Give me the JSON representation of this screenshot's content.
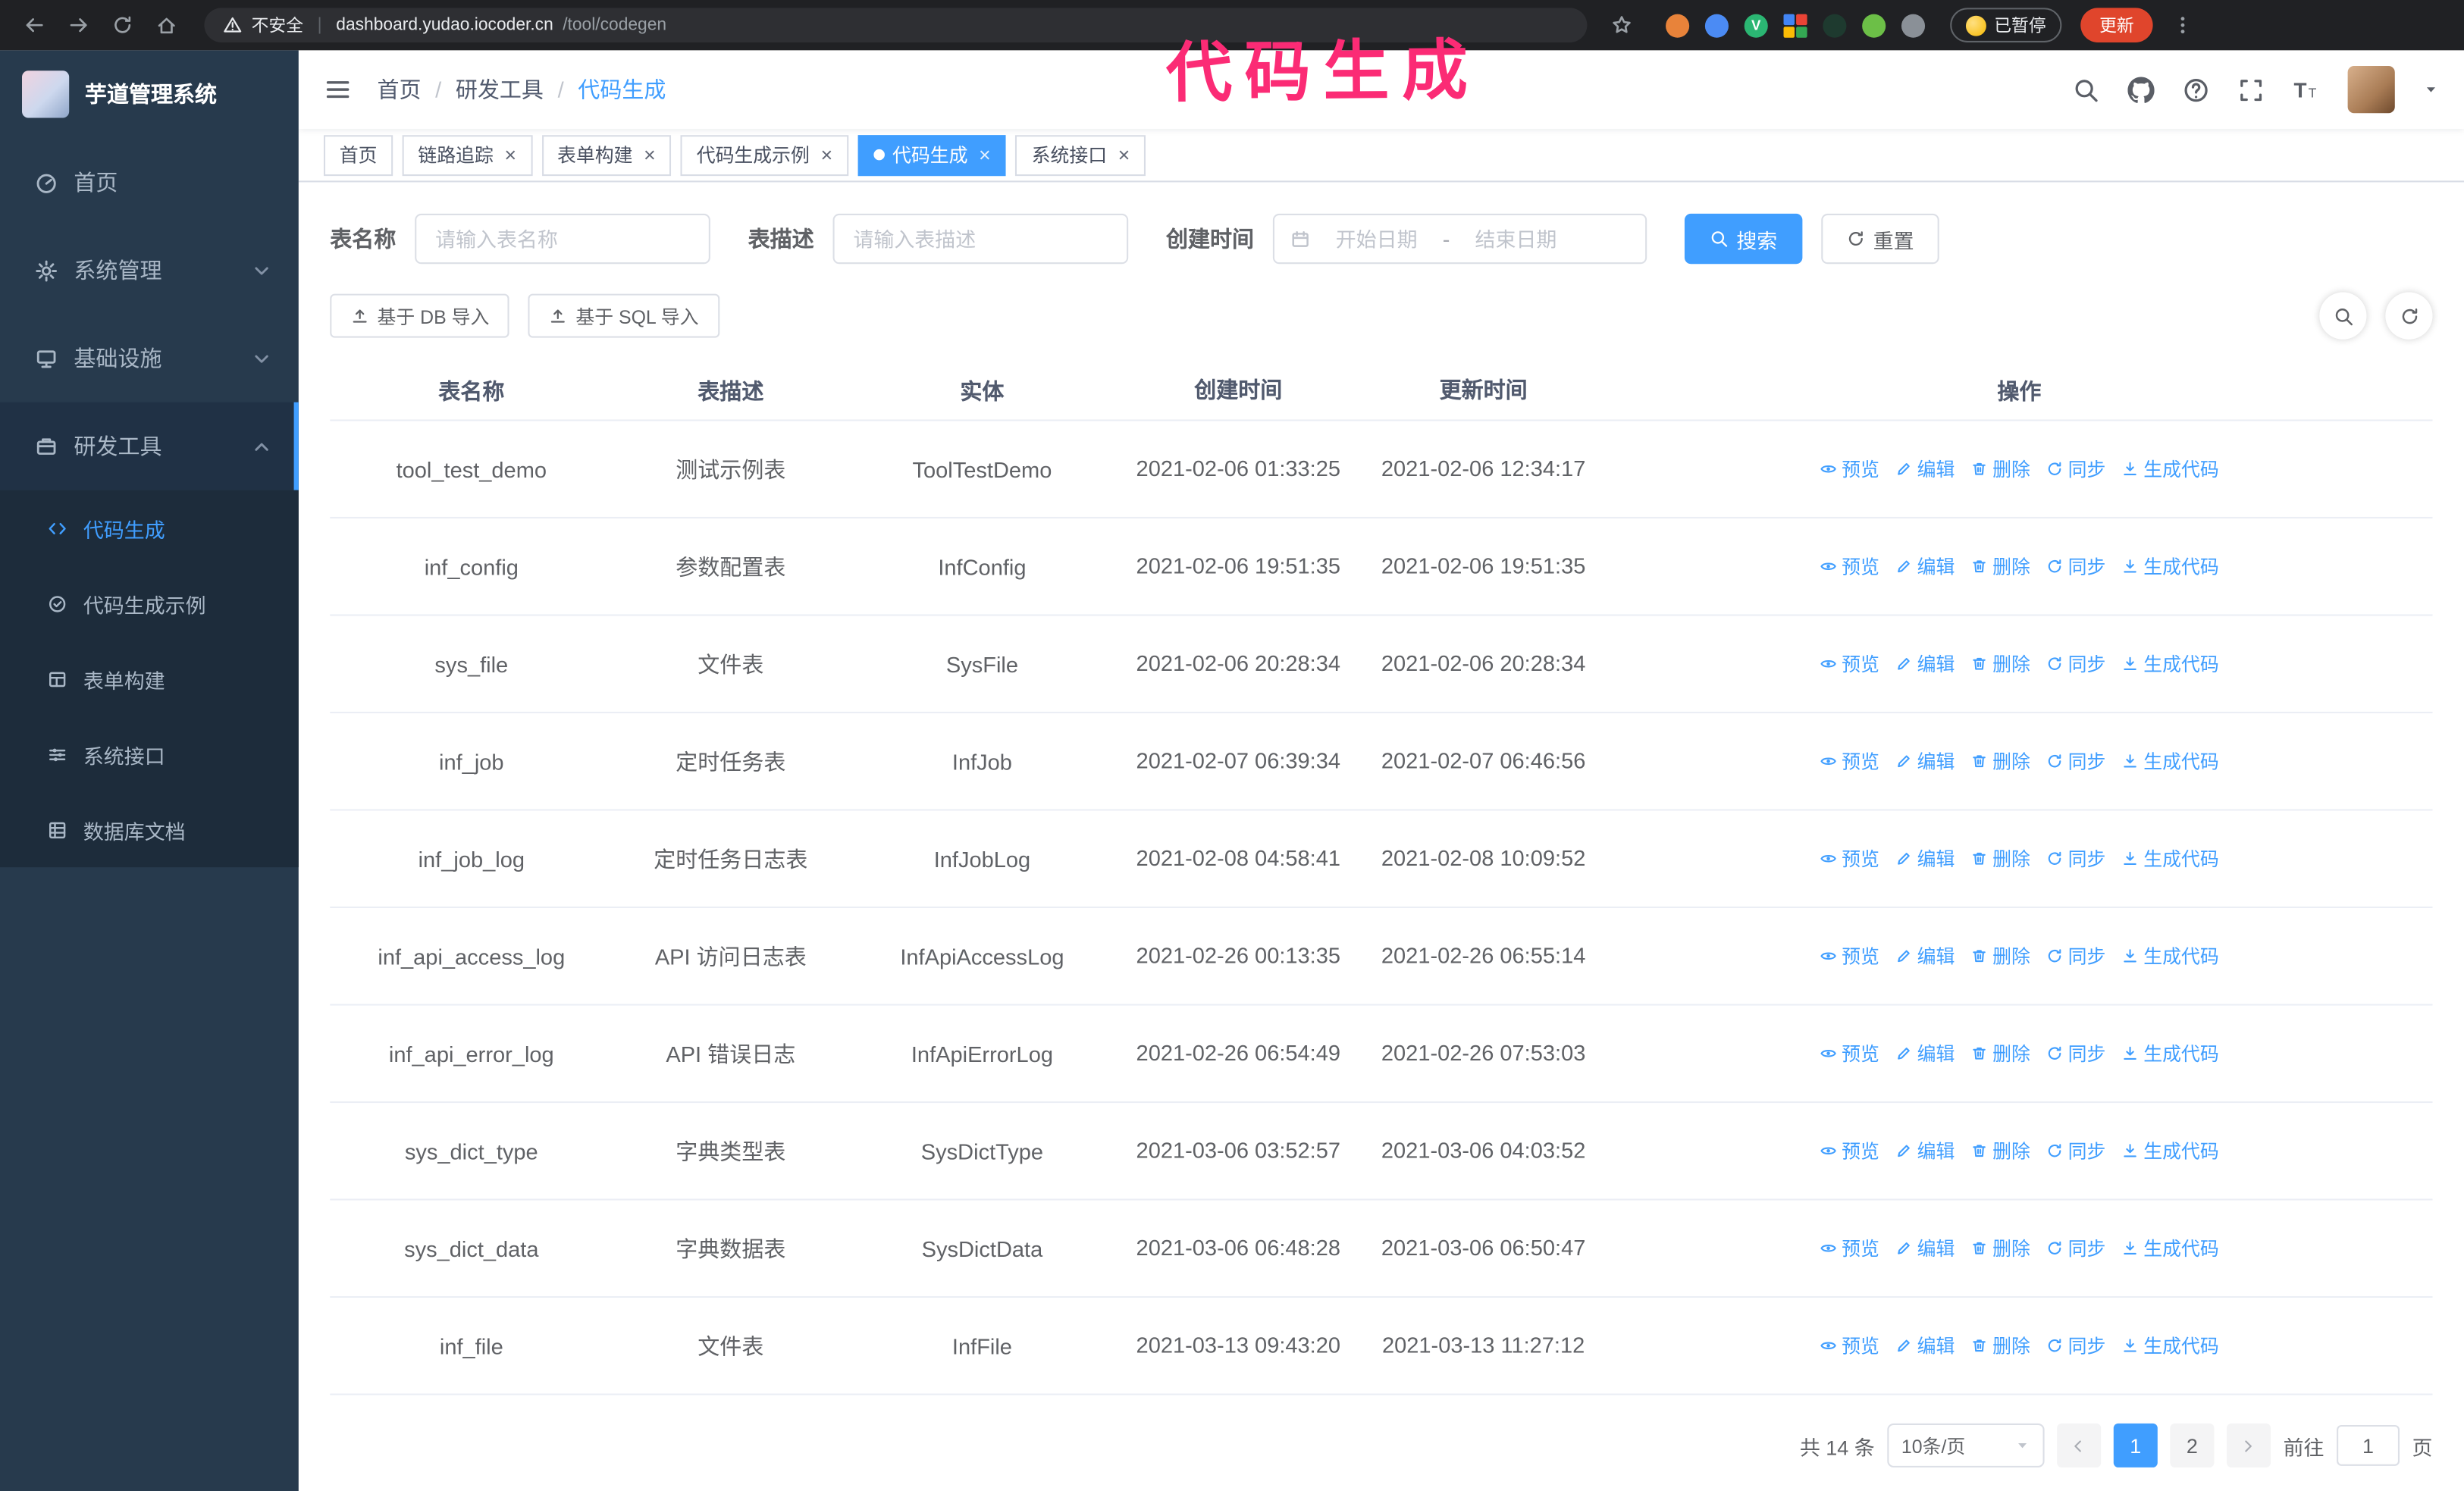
{
  "theme": {
    "primary_color": "#409eff",
    "sidebar_color": "#273a4d",
    "annotation_color": "#fb2b75"
  },
  "browser": {
    "security_label": "不安全",
    "url_host": "dashboard.yudao.iocoder.cn",
    "url_path": "/tool/codegen",
    "paused_badge": "已暂停",
    "update_button": "更新",
    "extensions": [
      {
        "key": "fox-extension-icon",
        "color": "#e8833a"
      },
      {
        "key": "blue-extension-icon",
        "color": "#4b8bf4"
      },
      {
        "key": "green-v-extension-icon",
        "color": "#2bb673",
        "glyph": "V"
      },
      {
        "key": "grid-extension-icon",
        "colors": [
          "#4285f4",
          "#ea4335",
          "#fbbc05",
          "#34a853"
        ]
      },
      {
        "key": "dark-green-extension-icon",
        "color": "#1e3a2f"
      },
      {
        "key": "leaf-extension-icon",
        "color": "#6cbf47"
      },
      {
        "key": "puzzle-extension-icon",
        "color": "#8a9097"
      }
    ]
  },
  "annotation": {
    "text": "代码生成"
  },
  "sidebar": {
    "logo_title": "芋道管理系统",
    "items": [
      {
        "key": "home",
        "label": "首页",
        "icon": "dashboard-icon",
        "expandable": false,
        "expanded": false,
        "active": false
      },
      {
        "key": "system",
        "label": "系统管理",
        "icon": "gear-icon",
        "expandable": true,
        "expanded": false,
        "active": false
      },
      {
        "key": "infra",
        "label": "基础设施",
        "icon": "infra-icon",
        "expandable": true,
        "expanded": false,
        "active": false
      },
      {
        "key": "devtools",
        "label": "研发工具",
        "icon": "tools-icon",
        "expandable": true,
        "expanded": true,
        "active": true
      }
    ],
    "sub_items": [
      {
        "key": "codegen",
        "label": "代码生成",
        "icon": "code-icon",
        "active": true
      },
      {
        "key": "codegen-example",
        "label": "代码生成示例",
        "icon": "example-icon",
        "active": false
      },
      {
        "key": "form-builder",
        "label": "表单构建",
        "icon": "form-icon",
        "active": false
      },
      {
        "key": "api",
        "label": "系统接口",
        "icon": "api-icon",
        "active": false
      },
      {
        "key": "db-doc",
        "label": "数据库文档",
        "icon": "db-doc-icon",
        "active": false
      }
    ]
  },
  "breadcrumb": {
    "items": [
      "首页",
      "研发工具",
      "代码生成"
    ],
    "separator": "/"
  },
  "tabs": [
    {
      "key": "home",
      "label": "首页",
      "closable": false,
      "active": false
    },
    {
      "key": "tracer",
      "label": "链路追踪",
      "closable": true,
      "active": false
    },
    {
      "key": "form-builder",
      "label": "表单构建",
      "closable": true,
      "active": false
    },
    {
      "key": "codegen-example",
      "label": "代码生成示例",
      "closable": true,
      "active": false
    },
    {
      "key": "codegen",
      "label": "代码生成",
      "closable": true,
      "active": true
    },
    {
      "key": "api",
      "label": "系统接口",
      "closable": true,
      "active": false
    }
  ],
  "filters": {
    "table_name_label": "表名称",
    "table_name_placeholder": "请输入表名称",
    "table_desc_label": "表描述",
    "table_desc_placeholder": "请输入表描述",
    "create_time_label": "创建时间",
    "start_date_placeholder": "开始日期",
    "range_separator": "-",
    "end_date_placeholder": "结束日期",
    "search_button": "搜索",
    "reset_button": "重置"
  },
  "toolbar": {
    "import_db_button": "基于 DB 导入",
    "import_sql_button": "基于 SQL 导入"
  },
  "table": {
    "headers": [
      "表名称",
      "表描述",
      "实体",
      "创建时间",
      "更新时间",
      "操作"
    ],
    "actions": [
      {
        "key": "preview",
        "label": "预览",
        "icon": "eye-icon"
      },
      {
        "key": "edit",
        "label": "编辑",
        "icon": "edit-icon"
      },
      {
        "key": "delete",
        "label": "删除",
        "icon": "delete-icon"
      },
      {
        "key": "sync",
        "label": "同步",
        "icon": "sync-icon"
      },
      {
        "key": "generate",
        "label": "生成代码",
        "icon": "gencode-icon"
      }
    ],
    "rows": [
      {
        "name": "tool_test_demo",
        "description": "测试示例表",
        "entity": "ToolTestDemo",
        "create_time": "2021-02-06 01:33:25",
        "update_time": "2021-02-06 12:34:17"
      },
      {
        "name": "inf_config",
        "description": "参数配置表",
        "entity": "InfConfig",
        "create_time": "2021-02-06 19:51:35",
        "update_time": "2021-02-06 19:51:35"
      },
      {
        "name": "sys_file",
        "description": "文件表",
        "entity": "SysFile",
        "create_time": "2021-02-06 20:28:34",
        "update_time": "2021-02-06 20:28:34"
      },
      {
        "name": "inf_job",
        "description": "定时任务表",
        "entity": "InfJob",
        "create_time": "2021-02-07 06:39:34",
        "update_time": "2021-02-07 06:46:56"
      },
      {
        "name": "inf_job_log",
        "description": "定时任务日志表",
        "entity": "InfJobLog",
        "create_time": "2021-02-08 04:58:41",
        "update_time": "2021-02-08 10:09:52"
      },
      {
        "name": "inf_api_access_log",
        "description": "API 访问日志表",
        "entity": "InfApiAccessLog",
        "create_time": "2021-02-26 00:13:35",
        "update_time": "2021-02-26 06:55:14"
      },
      {
        "name": "inf_api_error_log",
        "description": "API 错误日志",
        "entity": "InfApiErrorLog",
        "create_time": "2021-02-26 06:54:49",
        "update_time": "2021-02-26 07:53:03"
      },
      {
        "name": "sys_dict_type",
        "description": "字典类型表",
        "entity": "SysDictType",
        "create_time": "2021-03-06 03:52:57",
        "update_time": "2021-03-06 04:03:52"
      },
      {
        "name": "sys_dict_data",
        "description": "字典数据表",
        "entity": "SysDictData",
        "create_time": "2021-03-06 06:48:28",
        "update_time": "2021-03-06 06:50:47"
      },
      {
        "name": "inf_file",
        "description": "文件表",
        "entity": "InfFile",
        "create_time": "2021-03-13 09:43:20",
        "update_time": "2021-03-13 11:27:12"
      }
    ]
  },
  "pagination": {
    "total_text": "共 14 条",
    "page_size": "10条/页",
    "pages": [
      "1",
      "2"
    ],
    "active_page": "1",
    "goto_label": "前往",
    "goto_value": "1",
    "goto_suffix": "页"
  }
}
